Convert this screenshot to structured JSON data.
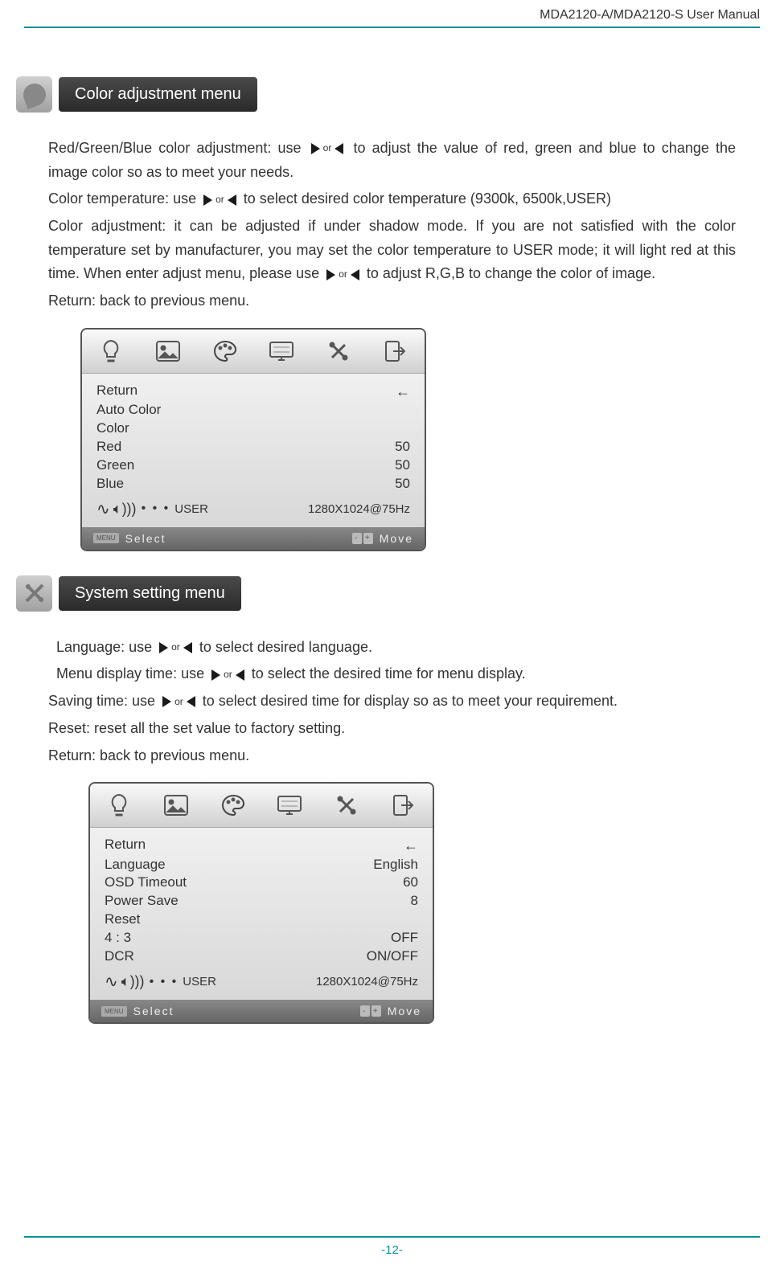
{
  "header": {
    "title": "MDA2120-A/MDA2120-S  User  Manual"
  },
  "colorMenu": {
    "title": "Color adjustment menu",
    "p1a": "Red/Green/Blue color adjustment: use",
    "p1b": "to adjust the value of red, green and blue to change the image color so as to meet your needs.",
    "p2a": "Color temperature: use",
    "p2b": "to select desired color temperature (9300k, 6500k,USER)",
    "p3a": "Color adjustment: it can be adjusted if under shadow mode. If you are not satisfied with the color temperature set by manufacturer, you may set the color temperature to USER mode; it will light red at this time. When enter adjust menu, please use",
    "p3b": "to adjust R,G,B to change the color of image.",
    "p4": "Return: back to previous menu.",
    "navOr": "or",
    "osd": {
      "rows": [
        {
          "label": "Return",
          "value": ""
        },
        {
          "label": "Auto Color",
          "value": ""
        },
        {
          "label": "Color",
          "value": ""
        },
        {
          "label": "Red",
          "value": "50"
        },
        {
          "label": "Green",
          "value": "50"
        },
        {
          "label": "Blue",
          "value": "50"
        }
      ],
      "user": "USER",
      "resolution": "1280X1024@75Hz",
      "menu": "MENU",
      "select": "Select",
      "move": "Move",
      "returnArrow": "←"
    }
  },
  "systemMenu": {
    "title": "System setting menu",
    "p1a": "Language: use",
    "p1b": "to select desired language.",
    "p2a": "Menu display time: use",
    "p2b": "to select the desired time for menu display.",
    "p3a": "Saving  time:  use",
    "p3b": "to  select  desired  time  for  display  so  as  to  meet  your requirement.",
    "p4": "Reset: reset all the set value to factory setting.",
    "p5": "Return: back to previous menu.",
    "osd": {
      "rows": [
        {
          "label": "Return",
          "value": ""
        },
        {
          "label": "Language",
          "value": "English"
        },
        {
          "label": "OSD Timeout",
          "value": "60"
        },
        {
          "label": "Power Save",
          "value": "8"
        },
        {
          "label": "Reset",
          "value": ""
        },
        {
          "label": "4 : 3",
          "value": "OFF"
        },
        {
          "label": "DCR",
          "value": "ON/OFF"
        }
      ],
      "user": "USER",
      "resolution": "1280X1024@75Hz",
      "menu": "MENU",
      "select": "Select",
      "move": "Move",
      "returnArrow": "←"
    }
  },
  "pageNumber": "-12-"
}
